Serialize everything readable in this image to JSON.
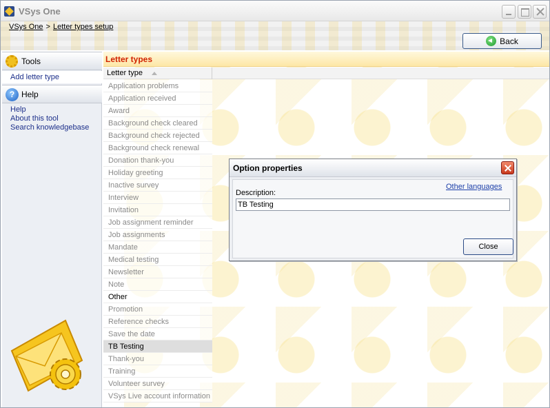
{
  "window": {
    "title": "VSys One"
  },
  "breadcrumb": {
    "items": [
      "VSys One",
      "Letter types setup"
    ],
    "separator": ">"
  },
  "header": {
    "back_label": "Back"
  },
  "sidebar": {
    "tools": {
      "title": "Tools",
      "items": [
        "Add letter type"
      ]
    },
    "help": {
      "title": "Help",
      "items": [
        "Help",
        "About this tool",
        "Search knowledgebase"
      ]
    }
  },
  "main": {
    "section_title": "Letter types",
    "column_header": "Letter type",
    "items": [
      "Application problems",
      "Application received",
      "Award",
      "Background check cleared",
      "Background check rejected",
      "Background check renewal",
      "Donation thank-you",
      "Holiday greeting",
      "Inactive survey",
      "Interview",
      "Invitation",
      "Job assignment reminder",
      "Job assignments",
      "Mandate",
      "Medical testing",
      "Newsletter",
      "Note",
      "Other",
      "Promotion",
      "Reference checks",
      "Save the date",
      "TB Testing",
      "Thank-you",
      "Training",
      "Volunteer survey",
      "VSys Live account information"
    ]
  },
  "dialog": {
    "title": "Option properties",
    "other_languages_label": "Other languages",
    "description_label": "Description:",
    "description_value": "TB Testing",
    "close_label": "Close"
  },
  "colors": {
    "section_title_text": "#d12300",
    "link_blue": "#1b3ea8",
    "dialog_close_red": "#c8391c"
  }
}
